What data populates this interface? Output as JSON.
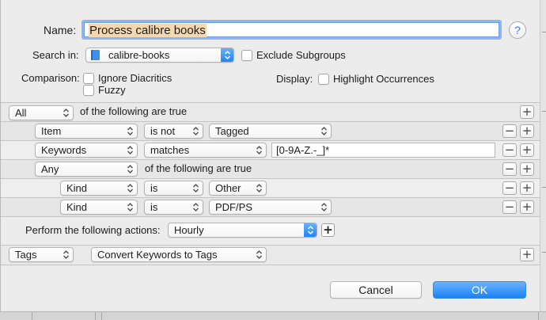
{
  "form": {
    "name_label": "Name:",
    "name_value": "Process calibre books",
    "help_label": "?",
    "search_in_label": "Search in:",
    "search_in_value": "calibre-books",
    "exclude_subgroups_label": "Exclude Subgroups",
    "comparison_label": "Comparison:",
    "ignore_diacritics_label": "Ignore Diacritics",
    "fuzzy_label": "Fuzzy",
    "display_label": "Display:",
    "highlight_occurrences_label": "Highlight Occurrences"
  },
  "conditions": {
    "top": {
      "quantifier": "All",
      "suffix": "of the following are true"
    },
    "rows": [
      {
        "field": "Item",
        "operator": "is not",
        "value": "Tagged"
      },
      {
        "field": "Keywords",
        "operator": "matches",
        "text": "[0-9A-Z.-_]*"
      },
      {
        "field": "Any",
        "suffix": "of the following are true"
      },
      {
        "field": "Kind",
        "operator": "is",
        "value": "Other"
      },
      {
        "field": "Kind",
        "operator": "is",
        "value": "PDF/PS"
      }
    ],
    "add_symbol": "+",
    "remove_symbol": "−"
  },
  "actions": {
    "label": "Perform the following actions:",
    "schedule_value": "Hourly",
    "add_symbol": "+",
    "row": {
      "type": "Tags",
      "action": "Convert Keywords to Tags"
    }
  },
  "buttons": {
    "cancel": "Cancel",
    "ok": "OK"
  },
  "colors": {
    "accent": "#1a82f7",
    "name_selection": "#f6d8b0",
    "focus_ring": "#8fb5ec"
  }
}
